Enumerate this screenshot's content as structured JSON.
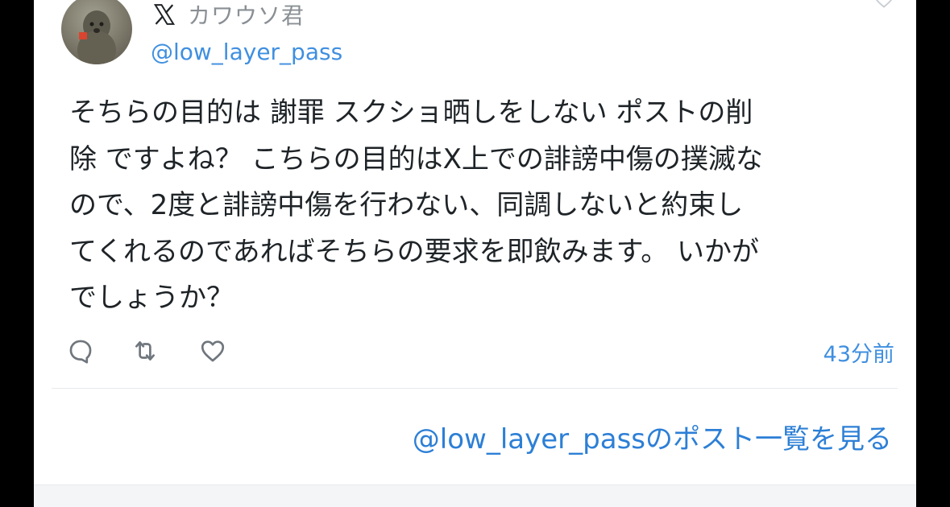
{
  "post": {
    "display_name": "カワウソ君",
    "handle": "@low_layer_pass",
    "text": "そちらの目的は 謝罪 スクショ晒しをしない ポストの削\n除 ですよね？ こちらの目的はX上での誹謗中傷の撲滅な\nので、2度と誹謗中傷を行わない、同調しないと約束し\nてくれるのであればそちらの要求を即飲みます。 いかが\nでしょうか？",
    "timestamp": "43分前"
  },
  "actions": {
    "reply_icon": "reply-icon",
    "retweet_icon": "retweet-icon",
    "like_icon": "heart-icon"
  },
  "footer": {
    "view_posts_link": "@low_layer_passのポスト一覧を見る"
  },
  "colors": {
    "accent": "#3f8fe0",
    "link": "#2c7fd6",
    "text": "#1e2327",
    "muted": "#8a8f94",
    "background": "#ffffff",
    "outer": "#000000"
  }
}
